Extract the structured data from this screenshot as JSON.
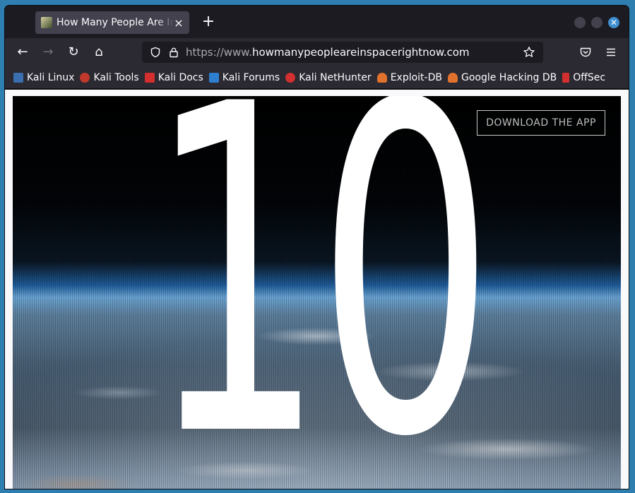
{
  "browser": {
    "tab": {
      "title": "How Many People Are In Space Right Now",
      "close": "×"
    },
    "new_tab": "+",
    "window_controls": {
      "close": "✕"
    },
    "nav": {
      "back": "←",
      "forward": "→",
      "reload": "↻",
      "home": "⌂"
    },
    "url": {
      "prefix": "https://www.",
      "domain": "howmanypeopleareinspacerightnow.com"
    },
    "bookmarks": [
      {
        "label": "Kali Linux",
        "icon": "kali-dragon-icon",
        "color": "#3a6fb0"
      },
      {
        "label": "Kali Tools",
        "icon": "kali-tools-icon",
        "color": "#c0392b"
      },
      {
        "label": "Kali Docs",
        "icon": "kali-docs-icon",
        "color": "#d32f2f"
      },
      {
        "label": "Kali Forums",
        "icon": "kali-forums-icon",
        "color": "#2f7fd0"
      },
      {
        "label": "Kali NetHunter",
        "icon": "nethunter-icon",
        "color": "#d32f2f"
      },
      {
        "label": "Exploit-DB",
        "icon": "exploit-db-icon",
        "color": "#e0722e"
      },
      {
        "label": "Google Hacking DB",
        "icon": "ghdb-icon",
        "color": "#e0722e"
      },
      {
        "label": "OffSec",
        "icon": "offsec-icon",
        "color": "#d32f2f"
      }
    ]
  },
  "page": {
    "people_count": "10",
    "download_button": "DOWNLOAD THE APP"
  }
}
